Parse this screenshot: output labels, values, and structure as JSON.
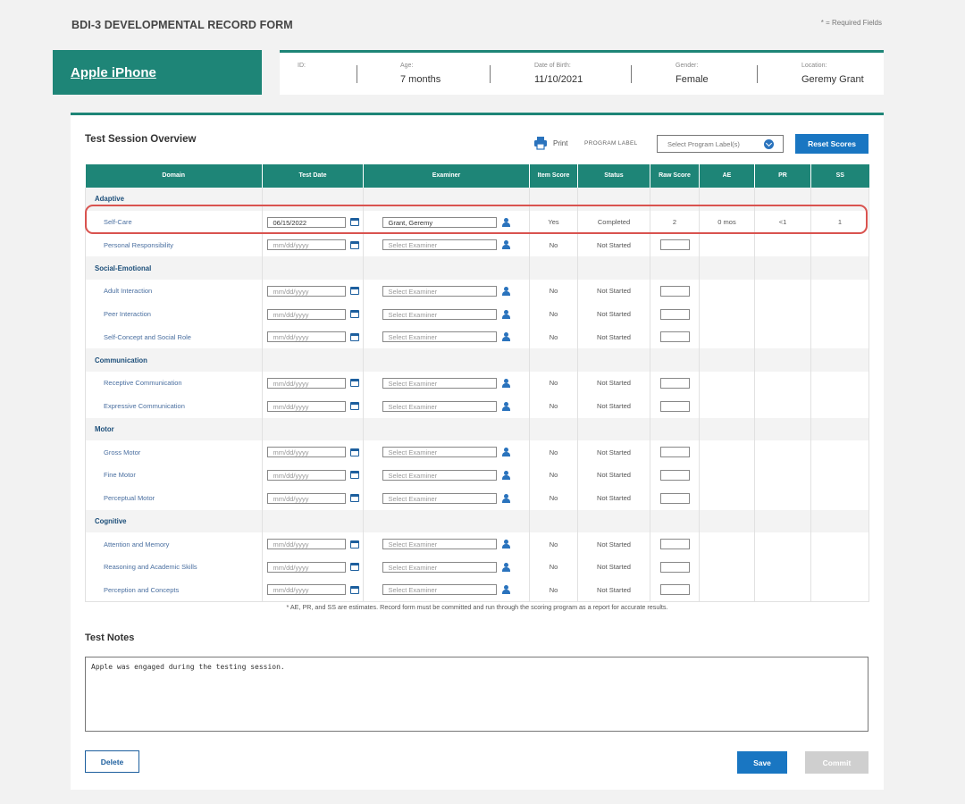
{
  "header": {
    "form_title": "BDI-3 DEVELOPMENTAL RECORD FORM",
    "required_note": "* = Required Fields"
  },
  "child": {
    "name": "Apple iPhone",
    "id_label": "ID:",
    "id_value": "",
    "age_label": "Age:",
    "age_value": "7 months",
    "dob_label": "Date of Birth:",
    "dob_value": "11/10/2021",
    "gender_label": "Gender:",
    "gender_value": "Female",
    "location_label": "Location:",
    "location_value": "Geremy Grant"
  },
  "overview": {
    "title": "Test Session Overview",
    "print_label": "Print",
    "program_label": "PROGRAM LABEL",
    "program_placeholder": "Select Program Label(s)",
    "reset_label": "Reset Scores"
  },
  "table": {
    "headers": {
      "domain": "Domain",
      "test_date": "Test Date",
      "examiner": "Examiner",
      "item_score": "Item Score",
      "status": "Status",
      "raw_score": "Raw Score",
      "ae": "AE",
      "pr": "PR",
      "ss": "SS"
    },
    "date_placeholder": "mm/dd/yyyy",
    "examiner_placeholder": "Select Examiner",
    "groups": [
      {
        "name": "Adaptive",
        "rows": [
          {
            "domain": "Self-Care",
            "date": "06/15/2022",
            "examiner": "Grant, Geremy",
            "item_score": "Yes",
            "status": "Completed",
            "raw": "2",
            "ae": "0 mos",
            "pr": "<1",
            "ss": "1"
          },
          {
            "domain": "Personal Responsibility",
            "date": "",
            "examiner": "",
            "item_score": "No",
            "status": "Not Started",
            "raw": "",
            "ae": "",
            "pr": "",
            "ss": ""
          }
        ]
      },
      {
        "name": "Social-Emotional",
        "rows": [
          {
            "domain": "Adult Interaction",
            "date": "",
            "examiner": "",
            "item_score": "No",
            "status": "Not Started",
            "raw": "",
            "ae": "",
            "pr": "",
            "ss": ""
          },
          {
            "domain": "Peer Interaction",
            "date": "",
            "examiner": "",
            "item_score": "No",
            "status": "Not Started",
            "raw": "",
            "ae": "",
            "pr": "",
            "ss": ""
          },
          {
            "domain": "Self-Concept and Social Role",
            "date": "",
            "examiner": "",
            "item_score": "No",
            "status": "Not Started",
            "raw": "",
            "ae": "",
            "pr": "",
            "ss": ""
          }
        ]
      },
      {
        "name": "Communication",
        "rows": [
          {
            "domain": "Receptive Communication",
            "date": "",
            "examiner": "",
            "item_score": "No",
            "status": "Not Started",
            "raw": "",
            "ae": "",
            "pr": "",
            "ss": ""
          },
          {
            "domain": "Expressive Communication",
            "date": "",
            "examiner": "",
            "item_score": "No",
            "status": "Not Started",
            "raw": "",
            "ae": "",
            "pr": "",
            "ss": ""
          }
        ]
      },
      {
        "name": "Motor",
        "rows": [
          {
            "domain": "Gross Motor",
            "date": "",
            "examiner": "",
            "item_score": "No",
            "status": "Not Started",
            "raw": "",
            "ae": "",
            "pr": "",
            "ss": ""
          },
          {
            "domain": "Fine Motor",
            "date": "",
            "examiner": "",
            "item_score": "No",
            "status": "Not Started",
            "raw": "",
            "ae": "",
            "pr": "",
            "ss": ""
          },
          {
            "domain": "Perceptual Motor",
            "date": "",
            "examiner": "",
            "item_score": "No",
            "status": "Not Started",
            "raw": "",
            "ae": "",
            "pr": "",
            "ss": ""
          }
        ]
      },
      {
        "name": "Cognitive",
        "rows": [
          {
            "domain": "Attention and Memory",
            "date": "",
            "examiner": "",
            "item_score": "No",
            "status": "Not Started",
            "raw": "",
            "ae": "",
            "pr": "",
            "ss": ""
          },
          {
            "domain": "Reasoning and Academic Skills",
            "date": "",
            "examiner": "",
            "item_score": "No",
            "status": "Not Started",
            "raw": "",
            "ae": "",
            "pr": "",
            "ss": ""
          },
          {
            "domain": "Perception and Concepts",
            "date": "",
            "examiner": "",
            "item_score": "No",
            "status": "Not Started",
            "raw": "",
            "ae": "",
            "pr": "",
            "ss": ""
          }
        ]
      }
    ]
  },
  "footnote": "* AE, PR, and SS are estimates. Record form must be committed and run through the scoring program as a report for accurate results.",
  "notes": {
    "title": "Test Notes",
    "value": "Apple was engaged during the testing session."
  },
  "actions": {
    "delete_label": "Delete",
    "save_label": "Save",
    "commit_label": "Commit"
  },
  "colors": {
    "brand_teal": "#1e8577",
    "primary_blue": "#1976c2",
    "highlight_red": "#d9534f"
  }
}
